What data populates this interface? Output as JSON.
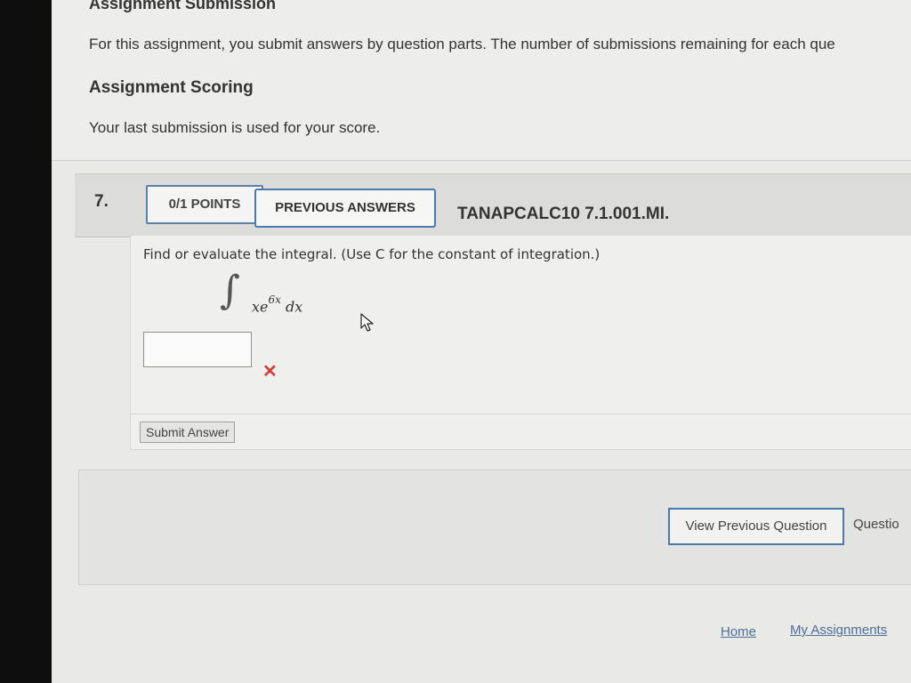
{
  "assignment": {
    "submission_title": "Assignment Submission",
    "submission_text": "For this assignment, you submit answers by question parts. The number of submissions remaining for each que",
    "scoring_heading": "Assignment Scoring",
    "scoring_text": "Your last submission is used for your score."
  },
  "question": {
    "number": "7.",
    "points_label": "0/1 POINTS",
    "previous_answers_label": "PREVIOUS ANSWERS",
    "problem_code": "TANAPCALC10 7.1.001.MI.",
    "prompt": "Find or evaluate the integral. (Use C for the constant of integration.)",
    "integral": {
      "sign": "∫",
      "base": "xe",
      "exponent": "6x",
      "differential": "dx"
    },
    "answer_value": "",
    "status_mark": "✕",
    "submit_label": "Submit Answer"
  },
  "navigation": {
    "view_previous_label": "View Previous Question",
    "next_label": "Questio"
  },
  "footer": {
    "home_label": "Home",
    "my_assignments_label": "My Assignments"
  },
  "colors": {
    "accent_border": "#4c78b0",
    "error_mark": "#d33d3d",
    "link": "#4c6e9a"
  },
  "icons": {
    "cursor": "mouse-pointer-icon",
    "incorrect": "x-mark-icon"
  }
}
